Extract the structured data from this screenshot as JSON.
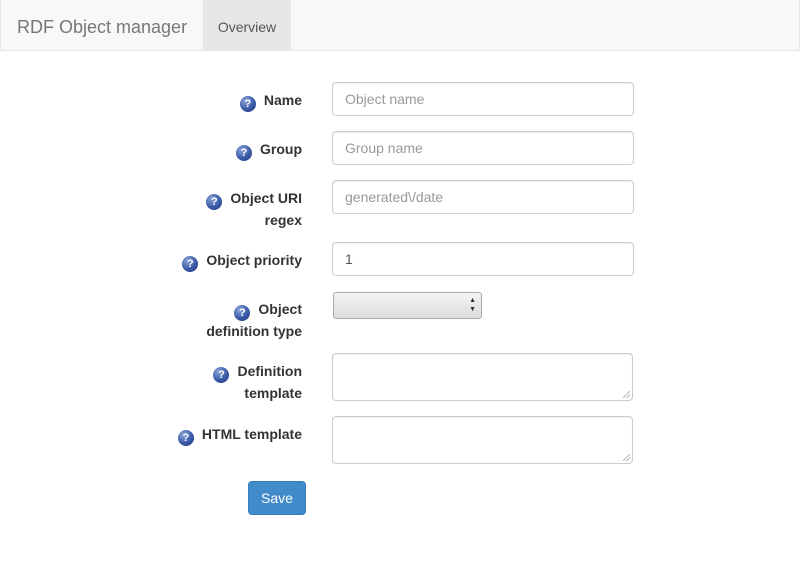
{
  "navbar": {
    "brand": "RDF Object manager",
    "tabs": [
      {
        "label": "Overview",
        "active": true
      }
    ]
  },
  "form": {
    "fields": [
      {
        "label": "Name",
        "type": "text",
        "placeholder": "Object name",
        "value": ""
      },
      {
        "label": "Group",
        "type": "text",
        "placeholder": "Group name",
        "value": ""
      },
      {
        "label_line1": "Object URI",
        "label_line2": "regex",
        "type": "text",
        "placeholder": "generated\\/date",
        "value": ""
      },
      {
        "label": "Object priority",
        "type": "text",
        "placeholder": "",
        "value": "1"
      },
      {
        "label_line1": "Object",
        "label_line2": "definition type",
        "type": "select",
        "selected": ""
      },
      {
        "label_line1": "Definition",
        "label_line2": "template",
        "type": "textarea",
        "value": ""
      },
      {
        "label": "HTML template",
        "type": "textarea",
        "value": ""
      }
    ],
    "help_icon_glyph": "?",
    "save_label": "Save"
  },
  "colors": {
    "navbar_bg": "#f8f8f8",
    "active_tab_bg": "#e7e7e7",
    "primary_button": "#428bca",
    "help_icon": "#3a5aa8"
  },
  "icons": {
    "help": "question-circle-icon",
    "select_arrows": "up-down-arrows-icon"
  }
}
